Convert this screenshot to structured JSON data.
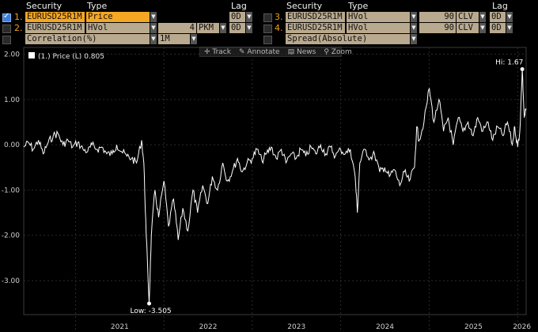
{
  "headers": {
    "left": {
      "security": "Security",
      "type": "Type",
      "lag": "Lag"
    },
    "right": {
      "security": "Security",
      "type": "Type",
      "lag": "Lag"
    }
  },
  "rows_left": [
    {
      "num": "1.",
      "checked": true,
      "security": "EURUSD25R1M",
      "type": "Price",
      "lag": "0D"
    },
    {
      "num": "2.",
      "checked": false,
      "security": "EURUSD25R1M",
      "type": "HVol",
      "param": "4",
      "unit": "PKM",
      "lag": "0D"
    },
    {
      "num": "",
      "checked": false,
      "security": "Correlation(%)",
      "period": "1M"
    }
  ],
  "rows_right": [
    {
      "num": "3.",
      "checked": false,
      "security": "EURUSD25R1M",
      "type": "HVol",
      "param": "90",
      "unit": "CLV",
      "lag": "0D"
    },
    {
      "num": "4.",
      "checked": false,
      "security": "EURUSD25R1M",
      "type": "HVol",
      "param": "90",
      "unit": "CLV",
      "lag": "0D"
    },
    {
      "num": "",
      "checked": false,
      "security": "Spread(Absolute)"
    }
  ],
  "toolbar": {
    "track": "Track",
    "annotate": "Annotate",
    "news": "News",
    "zoom": "Zoom"
  },
  "legend": {
    "label": "(1.) Price (L)",
    "value": "0.805"
  },
  "annotations": {
    "high": "Hi: 1.67",
    "low": "Low: -3.505"
  },
  "colors": {
    "line": "#ffffff",
    "background": "#000000",
    "grid": "#2b2b2b",
    "accent": "#f5a623"
  },
  "chart_data": {
    "type": "line",
    "title": "",
    "xlabel": "",
    "ylabel": "",
    "y_ticks": [
      "2.00",
      "1.00",
      "0.00",
      "-1.00",
      "-2.00",
      "-3.00"
    ],
    "x_ticks": [
      "2021",
      "2022",
      "2023",
      "2024",
      "2025",
      "2026"
    ],
    "ylim": [
      -3.75,
      2.15
    ],
    "xlim": [
      "2020-06-01",
      "2026-02-05"
    ],
    "grid": true,
    "legend_position": "top-left",
    "series": [
      {
        "name": "(1.) Price (L)",
        "points": [
          [
            "2020-06-01",
            -0.05
          ],
          [
            "2020-06-20",
            0.05
          ],
          [
            "2020-07-10",
            -0.1
          ],
          [
            "2020-08-01",
            0.1
          ],
          [
            "2020-08-20",
            -0.2
          ],
          [
            "2020-09-10",
            0.05
          ],
          [
            "2020-10-01",
            0.2
          ],
          [
            "2020-10-20",
            0.25
          ],
          [
            "2020-11-10",
            0.0
          ],
          [
            "2020-12-01",
            0.1
          ],
          [
            "2020-12-20",
            -0.05
          ],
          [
            "2021-01-10",
            0.05
          ],
          [
            "2021-02-01",
            -0.1
          ],
          [
            "2021-02-20",
            -0.15
          ],
          [
            "2021-03-10",
            0.0
          ],
          [
            "2021-04-01",
            -0.1
          ],
          [
            "2021-04-20",
            -0.05
          ],
          [
            "2021-05-10",
            -0.2
          ],
          [
            "2021-06-01",
            -0.2
          ],
          [
            "2021-06-20",
            0.0
          ],
          [
            "2021-07-10",
            -0.15
          ],
          [
            "2021-08-01",
            -0.25
          ],
          [
            "2021-08-20",
            -0.3
          ],
          [
            "2021-09-10",
            -0.4
          ],
          [
            "2021-10-01",
            0.1
          ],
          [
            "2021-10-10",
            -0.4
          ],
          [
            "2021-10-20",
            -2.0
          ],
          [
            "2021-11-01",
            -3.505
          ],
          [
            "2021-11-10",
            -2.0
          ],
          [
            "2021-11-25",
            -1.0
          ],
          [
            "2021-12-10",
            -1.6
          ],
          [
            "2022-01-01",
            -0.8
          ],
          [
            "2022-01-20",
            -1.8
          ],
          [
            "2022-02-10",
            -1.2
          ],
          [
            "2022-03-01",
            -2.1
          ],
          [
            "2022-03-20",
            -1.4
          ],
          [
            "2022-04-10",
            -1.9
          ],
          [
            "2022-05-01",
            -1.0
          ],
          [
            "2022-05-20",
            -1.5
          ],
          [
            "2022-06-10",
            -0.9
          ],
          [
            "2022-07-01",
            -1.3
          ],
          [
            "2022-07-20",
            -0.7
          ],
          [
            "2022-08-10",
            -1.0
          ],
          [
            "2022-09-01",
            -0.4
          ],
          [
            "2022-09-20",
            -0.8
          ],
          [
            "2022-10-10",
            -0.6
          ],
          [
            "2022-11-01",
            -0.3
          ],
          [
            "2022-11-20",
            -0.6
          ],
          [
            "2022-12-10",
            -0.4
          ],
          [
            "2023-01-01",
            -0.3
          ],
          [
            "2023-01-20",
            -0.1
          ],
          [
            "2023-02-10",
            -0.35
          ],
          [
            "2023-03-01",
            -0.2
          ],
          [
            "2023-03-20",
            -0.05
          ],
          [
            "2023-04-10",
            -0.3
          ],
          [
            "2023-05-01",
            -0.1
          ],
          [
            "2023-05-20",
            -0.4
          ],
          [
            "2023-06-10",
            -0.2
          ],
          [
            "2023-07-01",
            -0.3
          ],
          [
            "2023-07-20",
            -0.1
          ],
          [
            "2023-08-10",
            -0.25
          ],
          [
            "2023-09-01",
            -0.05
          ],
          [
            "2023-09-20",
            -0.2
          ],
          [
            "2023-10-10",
            0.0
          ],
          [
            "2023-11-01",
            -0.2
          ],
          [
            "2023-11-20",
            -0.05
          ],
          [
            "2023-12-10",
            -0.25
          ],
          [
            "2024-01-01",
            -0.1
          ],
          [
            "2024-01-20",
            -0.2
          ],
          [
            "2024-02-10",
            -0.1
          ],
          [
            "2024-03-01",
            -0.7
          ],
          [
            "2024-03-10",
            -1.5
          ],
          [
            "2024-03-20",
            -0.4
          ],
          [
            "2024-04-10",
            -0.1
          ],
          [
            "2024-05-01",
            -0.3
          ],
          [
            "2024-05-20",
            -0.2
          ],
          [
            "2024-06-10",
            -0.6
          ],
          [
            "2024-07-01",
            -0.5
          ],
          [
            "2024-07-20",
            -0.7
          ],
          [
            "2024-08-10",
            -0.55
          ],
          [
            "2024-09-01",
            -0.9
          ],
          [
            "2024-09-20",
            -0.6
          ],
          [
            "2024-10-10",
            -0.8
          ],
          [
            "2024-11-01",
            -0.5
          ],
          [
            "2024-11-10",
            0.4
          ],
          [
            "2024-11-20",
            0.1
          ],
          [
            "2024-12-10",
            0.5
          ],
          [
            "2025-01-01",
            1.25
          ],
          [
            "2025-01-20",
            0.5
          ],
          [
            "2025-02-10",
            1.0
          ],
          [
            "2025-03-01",
            0.3
          ],
          [
            "2025-03-20",
            0.6
          ],
          [
            "2025-04-10",
            0.0
          ],
          [
            "2025-05-01",
            0.6
          ],
          [
            "2025-05-20",
            0.3
          ],
          [
            "2025-06-10",
            0.5
          ],
          [
            "2025-07-01",
            0.2
          ],
          [
            "2025-07-20",
            0.6
          ],
          [
            "2025-08-10",
            0.3
          ],
          [
            "2025-09-01",
            0.5
          ],
          [
            "2025-09-20",
            0.1
          ],
          [
            "2025-10-10",
            0.4
          ],
          [
            "2025-11-01",
            0.2
          ],
          [
            "2025-11-20",
            0.5
          ],
          [
            "2025-12-10",
            0.0
          ],
          [
            "2025-12-20",
            0.4
          ],
          [
            "2026-01-01",
            -0.05
          ],
          [
            "2026-01-10",
            0.3
          ],
          [
            "2026-01-20",
            1.67
          ],
          [
            "2026-01-28",
            0.6
          ],
          [
            "2026-02-05",
            0.805
          ]
        ]
      }
    ]
  }
}
